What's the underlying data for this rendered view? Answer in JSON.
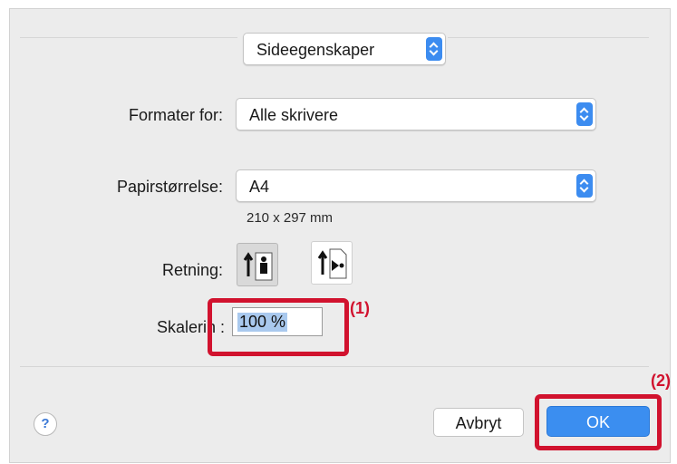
{
  "dialog": {
    "top_popup": {
      "value": "Sideegenskaper"
    },
    "format_for": {
      "label": "Formater for:",
      "value": "Alle skrivere"
    },
    "paper_size": {
      "label": "Papirstørrelse:",
      "value": "A4",
      "dimensions": "210 x 297 mm"
    },
    "orientation": {
      "label": "Retning:",
      "options": [
        "portrait",
        "landscape"
      ],
      "selected": "portrait"
    },
    "scaling": {
      "label": "Skalerin :",
      "value": "100 %"
    },
    "buttons": {
      "help": "?",
      "cancel": "Avbryt",
      "ok": "OK"
    }
  },
  "annotations": {
    "callout_1": "(1)",
    "callout_2": "(2)",
    "color": "#d1122e"
  },
  "colors": {
    "accent": "#3b8ef0",
    "dialog_bg": "#ececec"
  }
}
